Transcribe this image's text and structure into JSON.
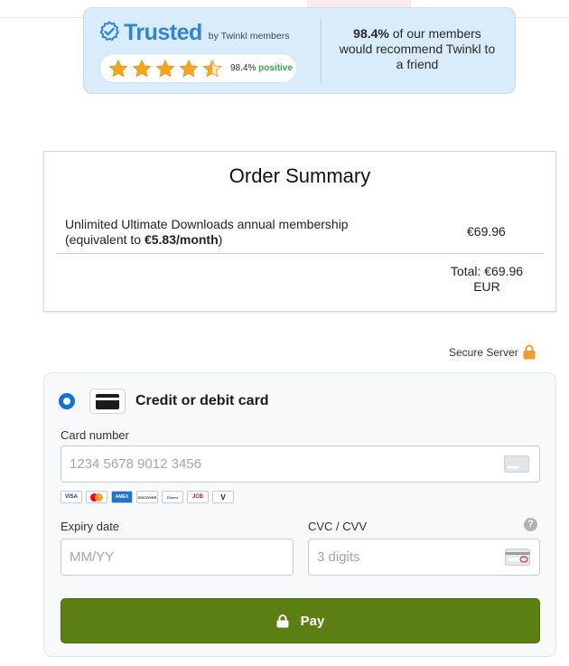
{
  "trust_banner": {
    "brand_word": "Trusted",
    "by_text": "by Twinkl members",
    "rating_percent": "98.4%",
    "rating_word": "positive",
    "star_rating": 4.5,
    "recommend_percent": "98.4%",
    "recommend_text": " of our members would recommend Twinkl to a friend",
    "brand_color": "#2f85d0"
  },
  "order_summary": {
    "title": "Order Summary",
    "item_description": "Unlimited Ultimate Downloads annual membership",
    "equivalent_prefix": "(equivalent to ",
    "equivalent_price": "€5.83/month",
    "equivalent_suffix": ")",
    "item_price": "€69.96",
    "total": "Total: €69.96",
    "currency": "EUR"
  },
  "secure": {
    "label": "Secure Server",
    "icon": "lock-icon",
    "color": "#f39a2c"
  },
  "payment": {
    "method_label": "Credit or debit card",
    "method_selected": true,
    "card_number_label": "Card number",
    "card_number_placeholder": "1234 5678 9012 3456",
    "card_brands": [
      "VISA",
      "Mastercard",
      "AMEX",
      "DISCOVER",
      "Diners",
      "JCB",
      "V"
    ],
    "expiry_label": "Expiry date",
    "expiry_placeholder": "MM/YY",
    "cvc_label": "CVC / CVV",
    "cvc_placeholder": "3 digits",
    "help_icon": "?",
    "pay_label": "Pay",
    "pay_color": "#5b7f12"
  }
}
